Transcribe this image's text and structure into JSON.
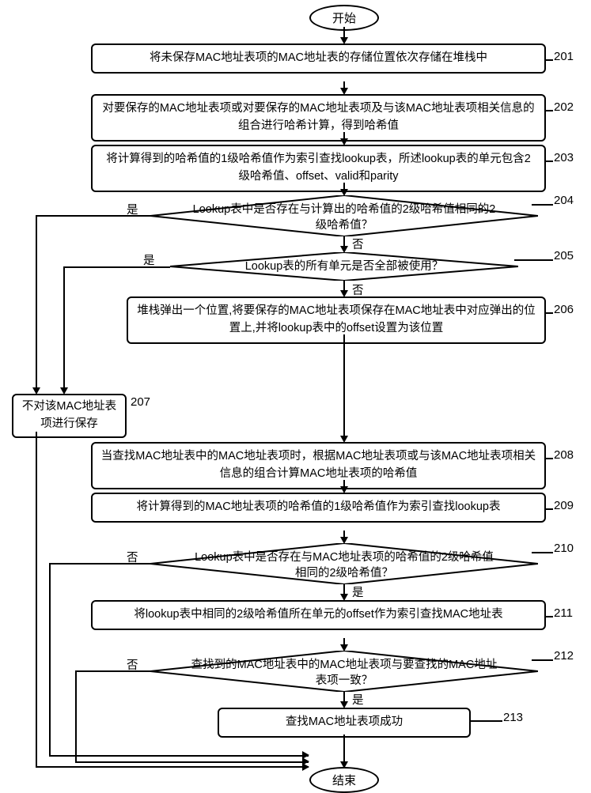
{
  "terminals": {
    "start": "开始",
    "end": "结束"
  },
  "steps": {
    "s201": "将未保存MAC地址表项的MAC地址表的存储位置依次存储在堆栈中",
    "s202": "对要保存的MAC地址表项或对要保存的MAC地址表项及与该MAC地址表项相关信息的组合进行哈希计算，得到哈希值",
    "s203": "将计算得到的哈希值的1级哈希值作为索引查找lookup表，所述lookup表的单元包含2级哈希值、offset、valid和parity",
    "s204": "Lookup表中是否存在与计算出的哈希值的2级哈希值相同的2级哈希值？",
    "s205": "Lookup表的所有单元是否全部被使用？",
    "s206": "堆栈弹出一个位置,将要保存的MAC地址表项保存在MAC地址表中对应弹出的位置上,并将lookup表中的offset设置为该位置",
    "s207": "不对该MAC地址表项进行保存",
    "s208": "当查找MAC地址表中的MAC地址表项时，根据MAC地址表项或与该MAC地址表项相关信息的组合计算MAC地址表项的哈希值",
    "s209": "将计算得到的MAC地址表项的哈希值的1级哈希值作为索引查找lookup表",
    "s210": "Lookup表中是否存在与MAC地址表项的哈希值的2级哈希值相同的2级哈希值？",
    "s211": "将lookup表中相同的2级哈希值所在单元的offset作为索引查找MAC地址表",
    "s212": "查找到的MAC地址表中的MAC地址表项与要查找的MAC地址表项一致？",
    "s213": "查找MAC地址表项成功"
  },
  "labels": {
    "n201": "201",
    "n202": "202",
    "n203": "203",
    "n204": "204",
    "n205": "205",
    "n206": "206",
    "n207": "207",
    "n208": "208",
    "n209": "209",
    "n210": "210",
    "n211": "211",
    "n212": "212",
    "n213": "213"
  },
  "branches": {
    "yes": "是",
    "no": "否"
  }
}
